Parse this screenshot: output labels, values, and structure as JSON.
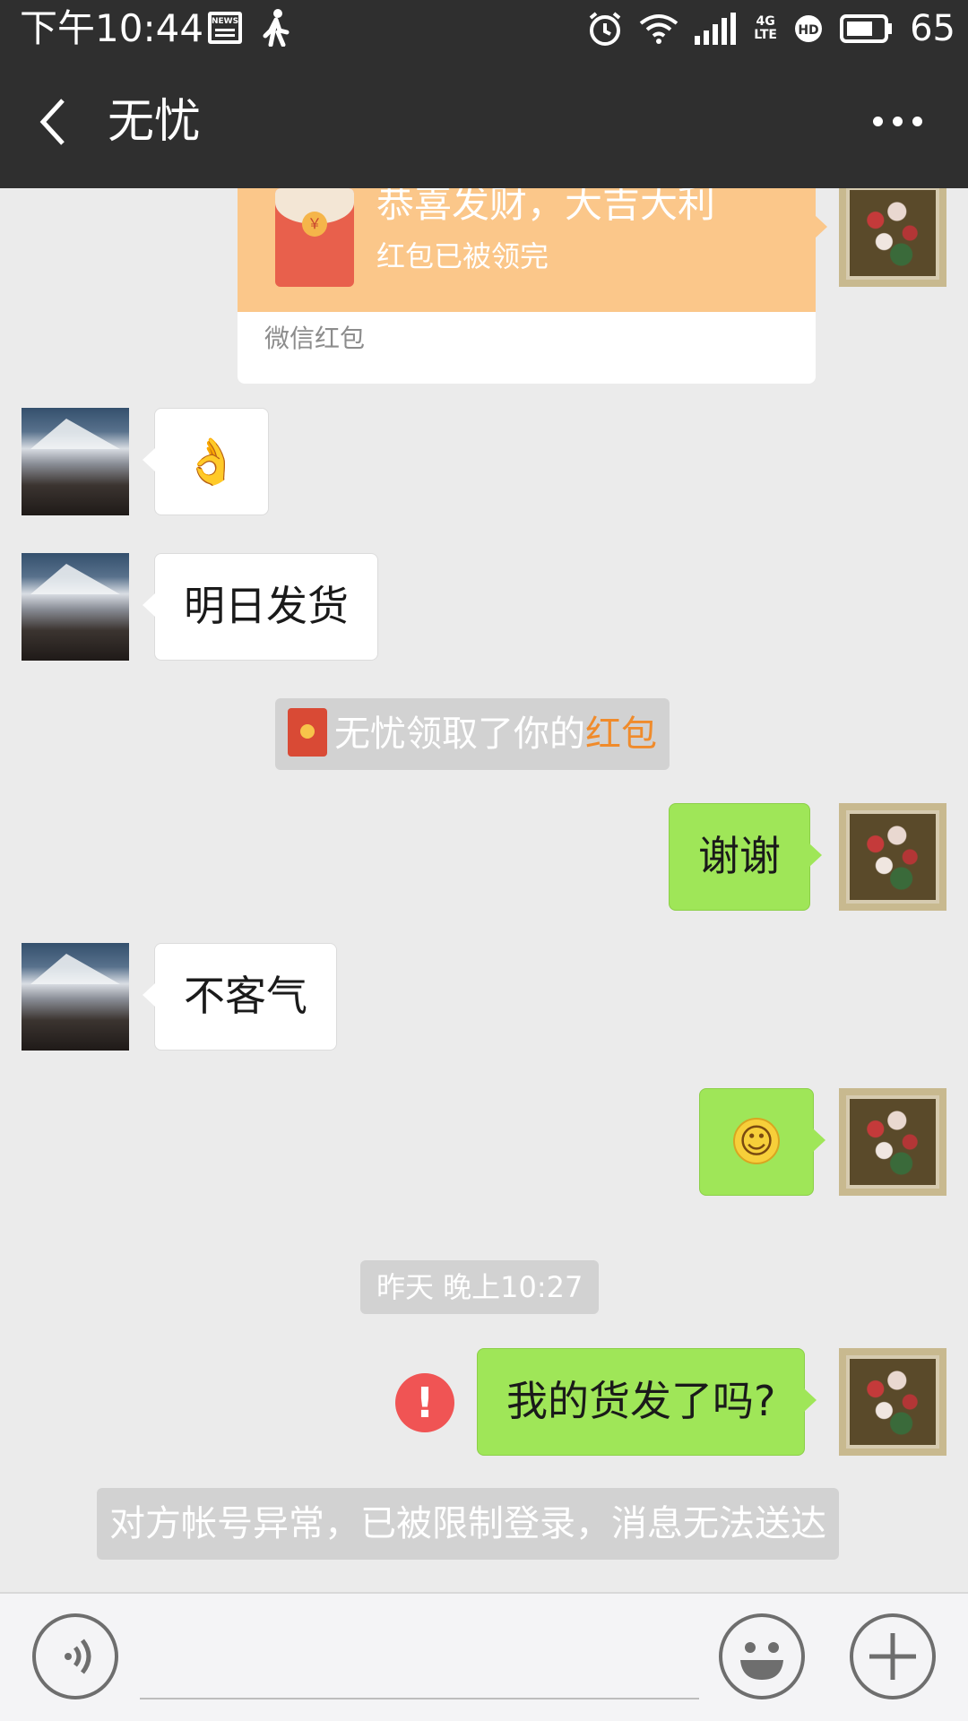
{
  "status_bar": {
    "time": "下午10:44",
    "news_icon_text": "NEWS",
    "network": "4G LTE",
    "hd": "HD",
    "battery": "65"
  },
  "header": {
    "title": "无忧"
  },
  "messages": {
    "red_packet": {
      "title": "恭喜发财，大吉大利",
      "status": "红包已被领完",
      "footer": "微信红包"
    },
    "msg_ok_emoji": "👌",
    "msg_ship": "明日发货",
    "system_received": {
      "prefix": "无忧领取了你的",
      "link": "红包"
    },
    "msg_thanks": "谢谢",
    "msg_welcome": "不客气",
    "msg_smile": "☺",
    "timestamp": "昨天 晚上10:27",
    "msg_question": "我的货发了吗?",
    "error_mark": "!",
    "system_error": "对方帐号异常，已被限制登录，消息无法送达"
  },
  "colors": {
    "bar_bg": "#2f2f2f",
    "chat_bg": "#ebebeb",
    "outgoing_bubble": "#9fe658",
    "incoming_bubble": "#ffffff",
    "red_packet": "#fbc78a",
    "error": "#f05454",
    "link_orange": "#f08b2b"
  },
  "icons": [
    "back-icon",
    "more-icon",
    "voice-icon",
    "emoji-icon",
    "plus-icon",
    "alarm-icon",
    "wifi-icon",
    "signal-icon",
    "battery-icon"
  ]
}
